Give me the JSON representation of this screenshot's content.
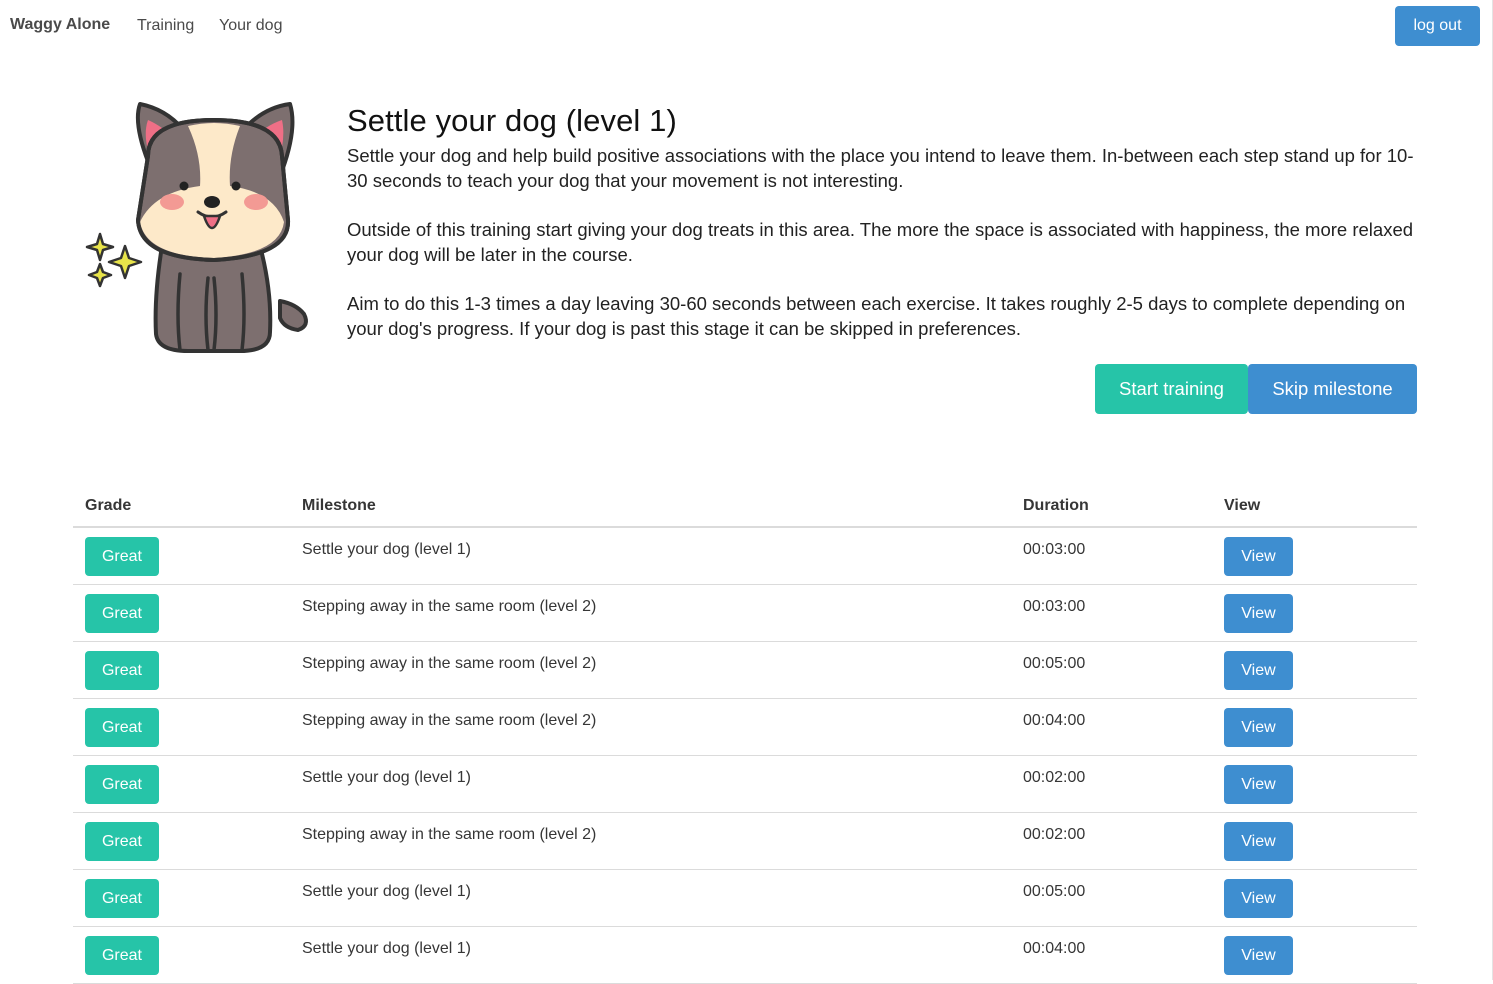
{
  "nav": {
    "brand": "Waggy Alone",
    "links": [
      "Training",
      "Your dog"
    ],
    "logout": "log out"
  },
  "hero": {
    "title": "Settle your dog (level 1)",
    "paragraphs": [
      "Settle your dog and help build positive associations with the place you intend to leave them. In-between each step stand up for 10-30 seconds to teach your dog that your movement is not interesting.",
      "Outside of this training start giving your dog treats in this area. The more the space is associated with happiness, the more relaxed your dog will be later in the course.",
      "Aim to do this 1-3 times a day leaving 30-60 seconds between each exercise. It takes roughly 2-5 days to complete depending on your dog's progress. If your dog is past this stage it can be skipped in preferences."
    ],
    "start_label": "Start training",
    "skip_label": "Skip milestone"
  },
  "colors": {
    "teal": "#26c4a8",
    "blue": "#3e8ed0"
  },
  "table": {
    "headers": [
      "Grade",
      "Milestone",
      "Duration",
      "View"
    ],
    "rows": [
      {
        "grade": "Great",
        "milestone": "Settle your dog (level 1)",
        "duration": "00:03:00",
        "view": "View"
      },
      {
        "grade": "Great",
        "milestone": "Stepping away in the same room (level 2)",
        "duration": "00:03:00",
        "view": "View"
      },
      {
        "grade": "Great",
        "milestone": "Stepping away in the same room (level 2)",
        "duration": "00:05:00",
        "view": "View"
      },
      {
        "grade": "Great",
        "milestone": "Stepping away in the same room (level 2)",
        "duration": "00:04:00",
        "view": "View"
      },
      {
        "grade": "Great",
        "milestone": "Settle your dog (level 1)",
        "duration": "00:02:00",
        "view": "View"
      },
      {
        "grade": "Great",
        "milestone": "Stepping away in the same room (level 2)",
        "duration": "00:02:00",
        "view": "View"
      },
      {
        "grade": "Great",
        "milestone": "Settle your dog (level 1)",
        "duration": "00:05:00",
        "view": "View"
      },
      {
        "grade": "Great",
        "milestone": "Settle your dog (level 1)",
        "duration": "00:04:00",
        "view": "View"
      }
    ]
  }
}
